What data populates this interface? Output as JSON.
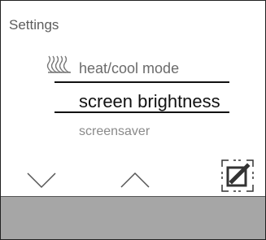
{
  "screen": {
    "title": "Settings"
  },
  "menu": {
    "items": [
      {
        "label": "heat/cool mode",
        "icon": "heat-waves-icon",
        "state": "previous"
      },
      {
        "label": "screen brightness",
        "state": "selected"
      },
      {
        "label": "screensaver",
        "state": "next"
      }
    ]
  },
  "controls": {
    "down_icon": "chevron-down-icon",
    "up_icon": "chevron-up-icon",
    "edit_icon": "edit-icon"
  },
  "colors": {
    "footer": "#a6a6a6",
    "selected_text": "#111111",
    "dim_text": "#8a8a8a"
  }
}
